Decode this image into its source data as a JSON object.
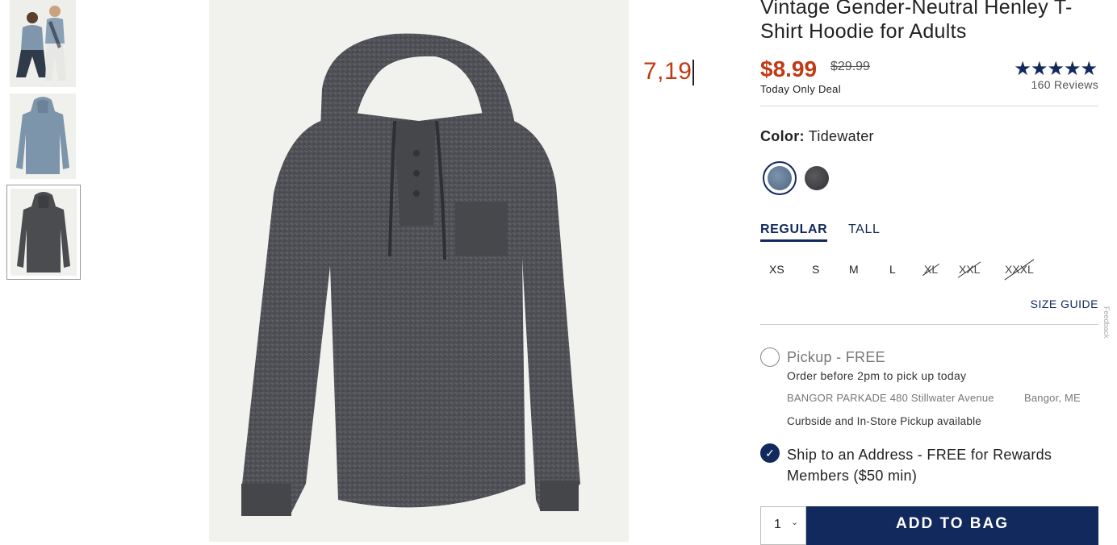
{
  "gallery": {
    "thumbnails": [
      {
        "name": "thumb-model-couple"
      },
      {
        "name": "thumb-tidewater-hoodie"
      },
      {
        "name": "thumb-charcoal-hoodie",
        "selected": true
      }
    ]
  },
  "overlay": {
    "value": "7,19"
  },
  "product": {
    "title": "Vintage Gender-Neutral Henley T-Shirt Hoodie for Adults",
    "price": "$8.99",
    "original_price": "$29.99",
    "deal_label": "Today Only Deal",
    "rating": 4.5,
    "stars": "★★★★★",
    "reviews": "160 Reviews"
  },
  "color": {
    "label": "Color:",
    "selected": "Tidewater",
    "swatches": [
      {
        "name": "Tidewater",
        "hex": "#5f7894"
      },
      {
        "name": "Charcoal",
        "hex": "#434346"
      }
    ]
  },
  "fit_tabs": {
    "regular": "REGULAR",
    "tall": "TALL",
    "active": "REGULAR"
  },
  "sizes": [
    {
      "label": "XS",
      "available": true
    },
    {
      "label": "S",
      "available": true
    },
    {
      "label": "M",
      "available": true
    },
    {
      "label": "L",
      "available": true
    },
    {
      "label": "XL",
      "available": false
    },
    {
      "label": "XXL",
      "available": false
    },
    {
      "label": "XXXL",
      "available": false
    }
  ],
  "size_guide": "SIZE GUIDE",
  "fulfillment": {
    "pickup": {
      "title": "Pickup - FREE",
      "subtitle": "Order before 2pm to pick up today",
      "address": "BANGOR PARKADE 480 Stillwater Avenue",
      "city": "Bangor, ME",
      "note": "Curbside and In-Store Pickup available",
      "selected": false
    },
    "ship": {
      "title": "Ship to an Address - FREE for Rewards Members ($50 min)",
      "selected": true
    }
  },
  "cart": {
    "quantity": "1",
    "add_label": "ADD TO BAG"
  },
  "colors": {
    "brand_navy": "#12295e",
    "price_red": "#c03a14"
  },
  "feedback_tab": "Feedback"
}
